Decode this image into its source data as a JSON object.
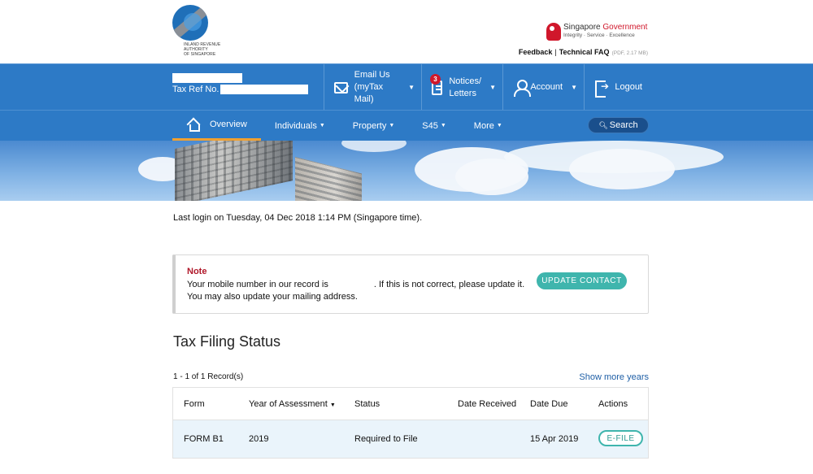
{
  "header": {
    "logo_text_lines": [
      "INLAND REVENUE",
      "AUTHORITY",
      "OF SINGAPORE"
    ],
    "gov_brand_prefix": "Singapore ",
    "gov_brand_suffix": "Government",
    "gov_tagline": "Integrity · Service · Excellence",
    "feedback_link": "Feedback",
    "separator": "|",
    "tech_faq_link": "Technical FAQ",
    "tech_faq_meta": "(PDF, 2.17 MB)",
    "brand_color": "#d0172b"
  },
  "user_bar": {
    "tax_ref_label": "Tax Ref No.",
    "email": {
      "label_line1": "Email Us",
      "label_line2": "(myTax Mail)",
      "icon": "envelope-icon"
    },
    "notices": {
      "label_line1": "Notices/",
      "label_line2": "Letters",
      "badge_count": "3",
      "icon": "document-icon"
    },
    "account": {
      "label": "Account",
      "icon": "person-icon"
    },
    "logout": {
      "label": "Logout",
      "icon": "logout-icon"
    },
    "caret": "▼",
    "bar_color": "#2d7ac6"
  },
  "nav": {
    "items": [
      {
        "label": "Overview",
        "active": true,
        "icon": "home-icon"
      },
      {
        "label": "Individuals",
        "has_dropdown": true
      },
      {
        "label": "Property",
        "has_dropdown": true
      },
      {
        "label": "S45",
        "has_dropdown": true
      },
      {
        "label": "More",
        "has_dropdown": true
      }
    ],
    "caret": "▼",
    "search_label": "Search",
    "search_icon": "🔍︎",
    "active_underline_color": "#f0a030"
  },
  "main": {
    "last_login": "Last login on Tuesday, 04 Dec 2018 1:14 PM (Singapore time).",
    "note": {
      "title": "Note",
      "line1_prefix": "Your mobile number in our record is",
      "line1_suffix": ". If this is not correct, please update it.",
      "line2": "You may also update your mailing address.",
      "button_label": "UPDATE CONTACT"
    },
    "filing_status": {
      "title": "Tax Filing Status",
      "records_count": "1 - 1 of 1 Record(s)",
      "show_more": "Show more years",
      "columns": [
        "Form",
        "Year of Assessment",
        "Status",
        "Date Received",
        "Date Due",
        "Actions"
      ],
      "sort_caret": "▼",
      "rows": [
        {
          "form": "FORM B1",
          "year": "2019",
          "status": "Required to File",
          "date_received": "",
          "date_due": "15 Apr 2019",
          "action": "E-FILE"
        }
      ],
      "accent_color": "#3fb5ad"
    }
  }
}
